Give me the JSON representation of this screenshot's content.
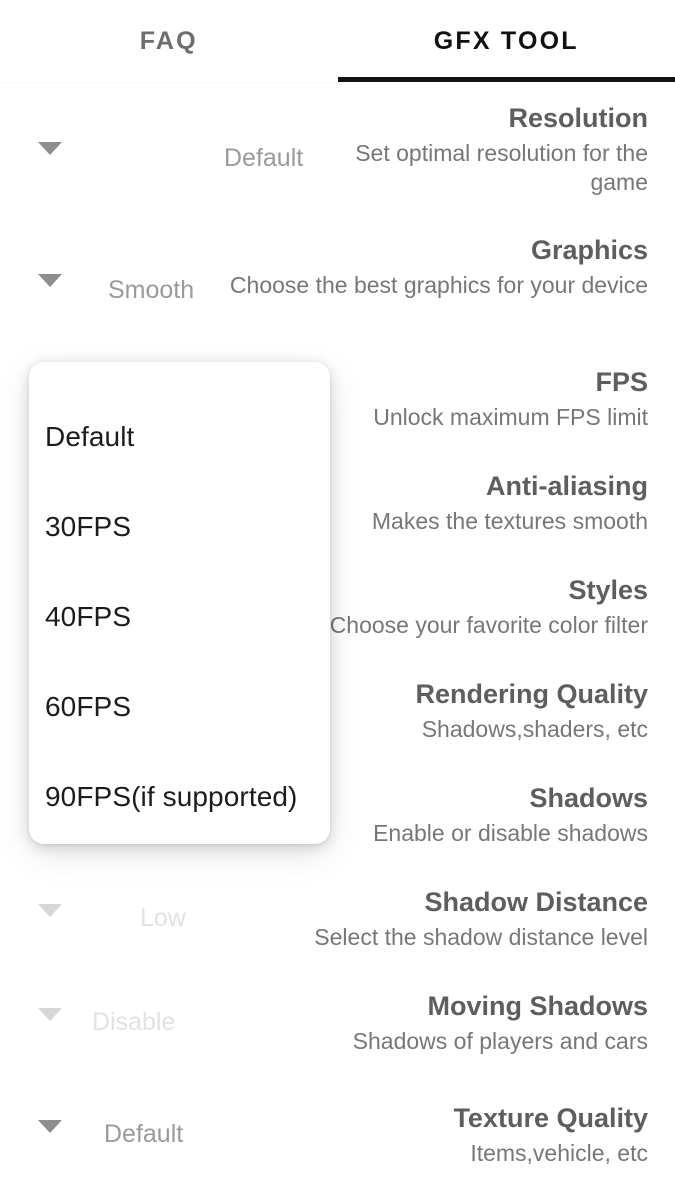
{
  "tabs": [
    {
      "label": "FAQ",
      "active": false
    },
    {
      "label": "GFX TOOL",
      "active": true
    }
  ],
  "settings": [
    {
      "title": "Resolution",
      "subtitle": "Set optimal resolution for the game",
      "value": "Default",
      "caret": "chevron-down-icon"
    },
    {
      "title": "Graphics",
      "subtitle": "Choose the best graphics for your device",
      "value": "Smooth",
      "caret": "chevron-down-icon"
    },
    {
      "title": "FPS",
      "subtitle": "Unlock maximum FPS limit",
      "value": "",
      "caret": "chevron-down-icon"
    },
    {
      "title": "Anti-aliasing",
      "subtitle": "Makes the textures smooth",
      "value": "",
      "caret": "chevron-down-icon"
    },
    {
      "title": "Styles",
      "subtitle": "Choose your favorite color filter",
      "value": "",
      "caret": "chevron-down-icon"
    },
    {
      "title": "Rendering Quality",
      "subtitle": "Shadows,shaders, etc",
      "value": "",
      "caret": "chevron-down-icon"
    },
    {
      "title": "Shadows",
      "subtitle": "Enable or disable shadows",
      "value": "",
      "caret": "chevron-down-icon"
    },
    {
      "title": "Shadow Distance",
      "subtitle": "Select the shadow distance level",
      "value": "Low",
      "caret": "chevron-down-icon"
    },
    {
      "title": "Moving Shadows",
      "subtitle": "Shadows of players and cars",
      "value": "Disable",
      "caret": "chevron-down-icon"
    },
    {
      "title": "Texture Quality",
      "subtitle": "Items,vehicle, etc",
      "value": "Default",
      "caret": "chevron-down-icon"
    }
  ],
  "dropdown": {
    "owner": "FPS",
    "options": [
      "Default",
      "30FPS",
      "40FPS",
      "60FPS",
      "90FPS(if supported)"
    ]
  },
  "colors": {
    "active_tab": "#101010",
    "inactive_tab": "#6e6e6e",
    "indicator": "#121212",
    "title": "#5e5e5e",
    "subtitle": "#777777",
    "value": "#9a9a9a",
    "dropdown_text": "#1c1c1c",
    "background": "#ffffff"
  }
}
